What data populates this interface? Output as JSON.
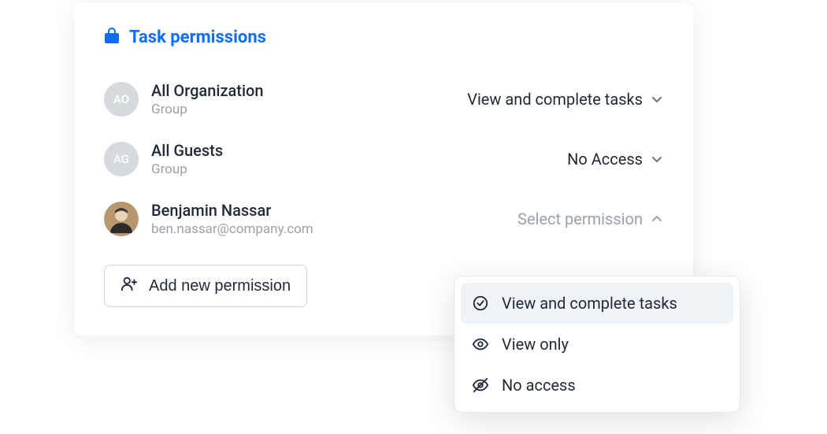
{
  "header": {
    "title": "Task permissions"
  },
  "rows": [
    {
      "initials": "AO",
      "name": "All Organization",
      "sub": "Group",
      "permission": "View and complete tasks",
      "open": false
    },
    {
      "initials": "AG",
      "name": "All Guests",
      "sub": "Group",
      "permission": "No Access",
      "open": false
    },
    {
      "name": "Benjamin Nassar",
      "sub": "ben.nassar@company.com",
      "permission": "Select permission",
      "open": true
    }
  ],
  "addButton": {
    "label": "Add new permission"
  },
  "dropdown": {
    "options": [
      {
        "label": "View and complete tasks"
      },
      {
        "label": "View only"
      },
      {
        "label": "No access"
      }
    ]
  }
}
